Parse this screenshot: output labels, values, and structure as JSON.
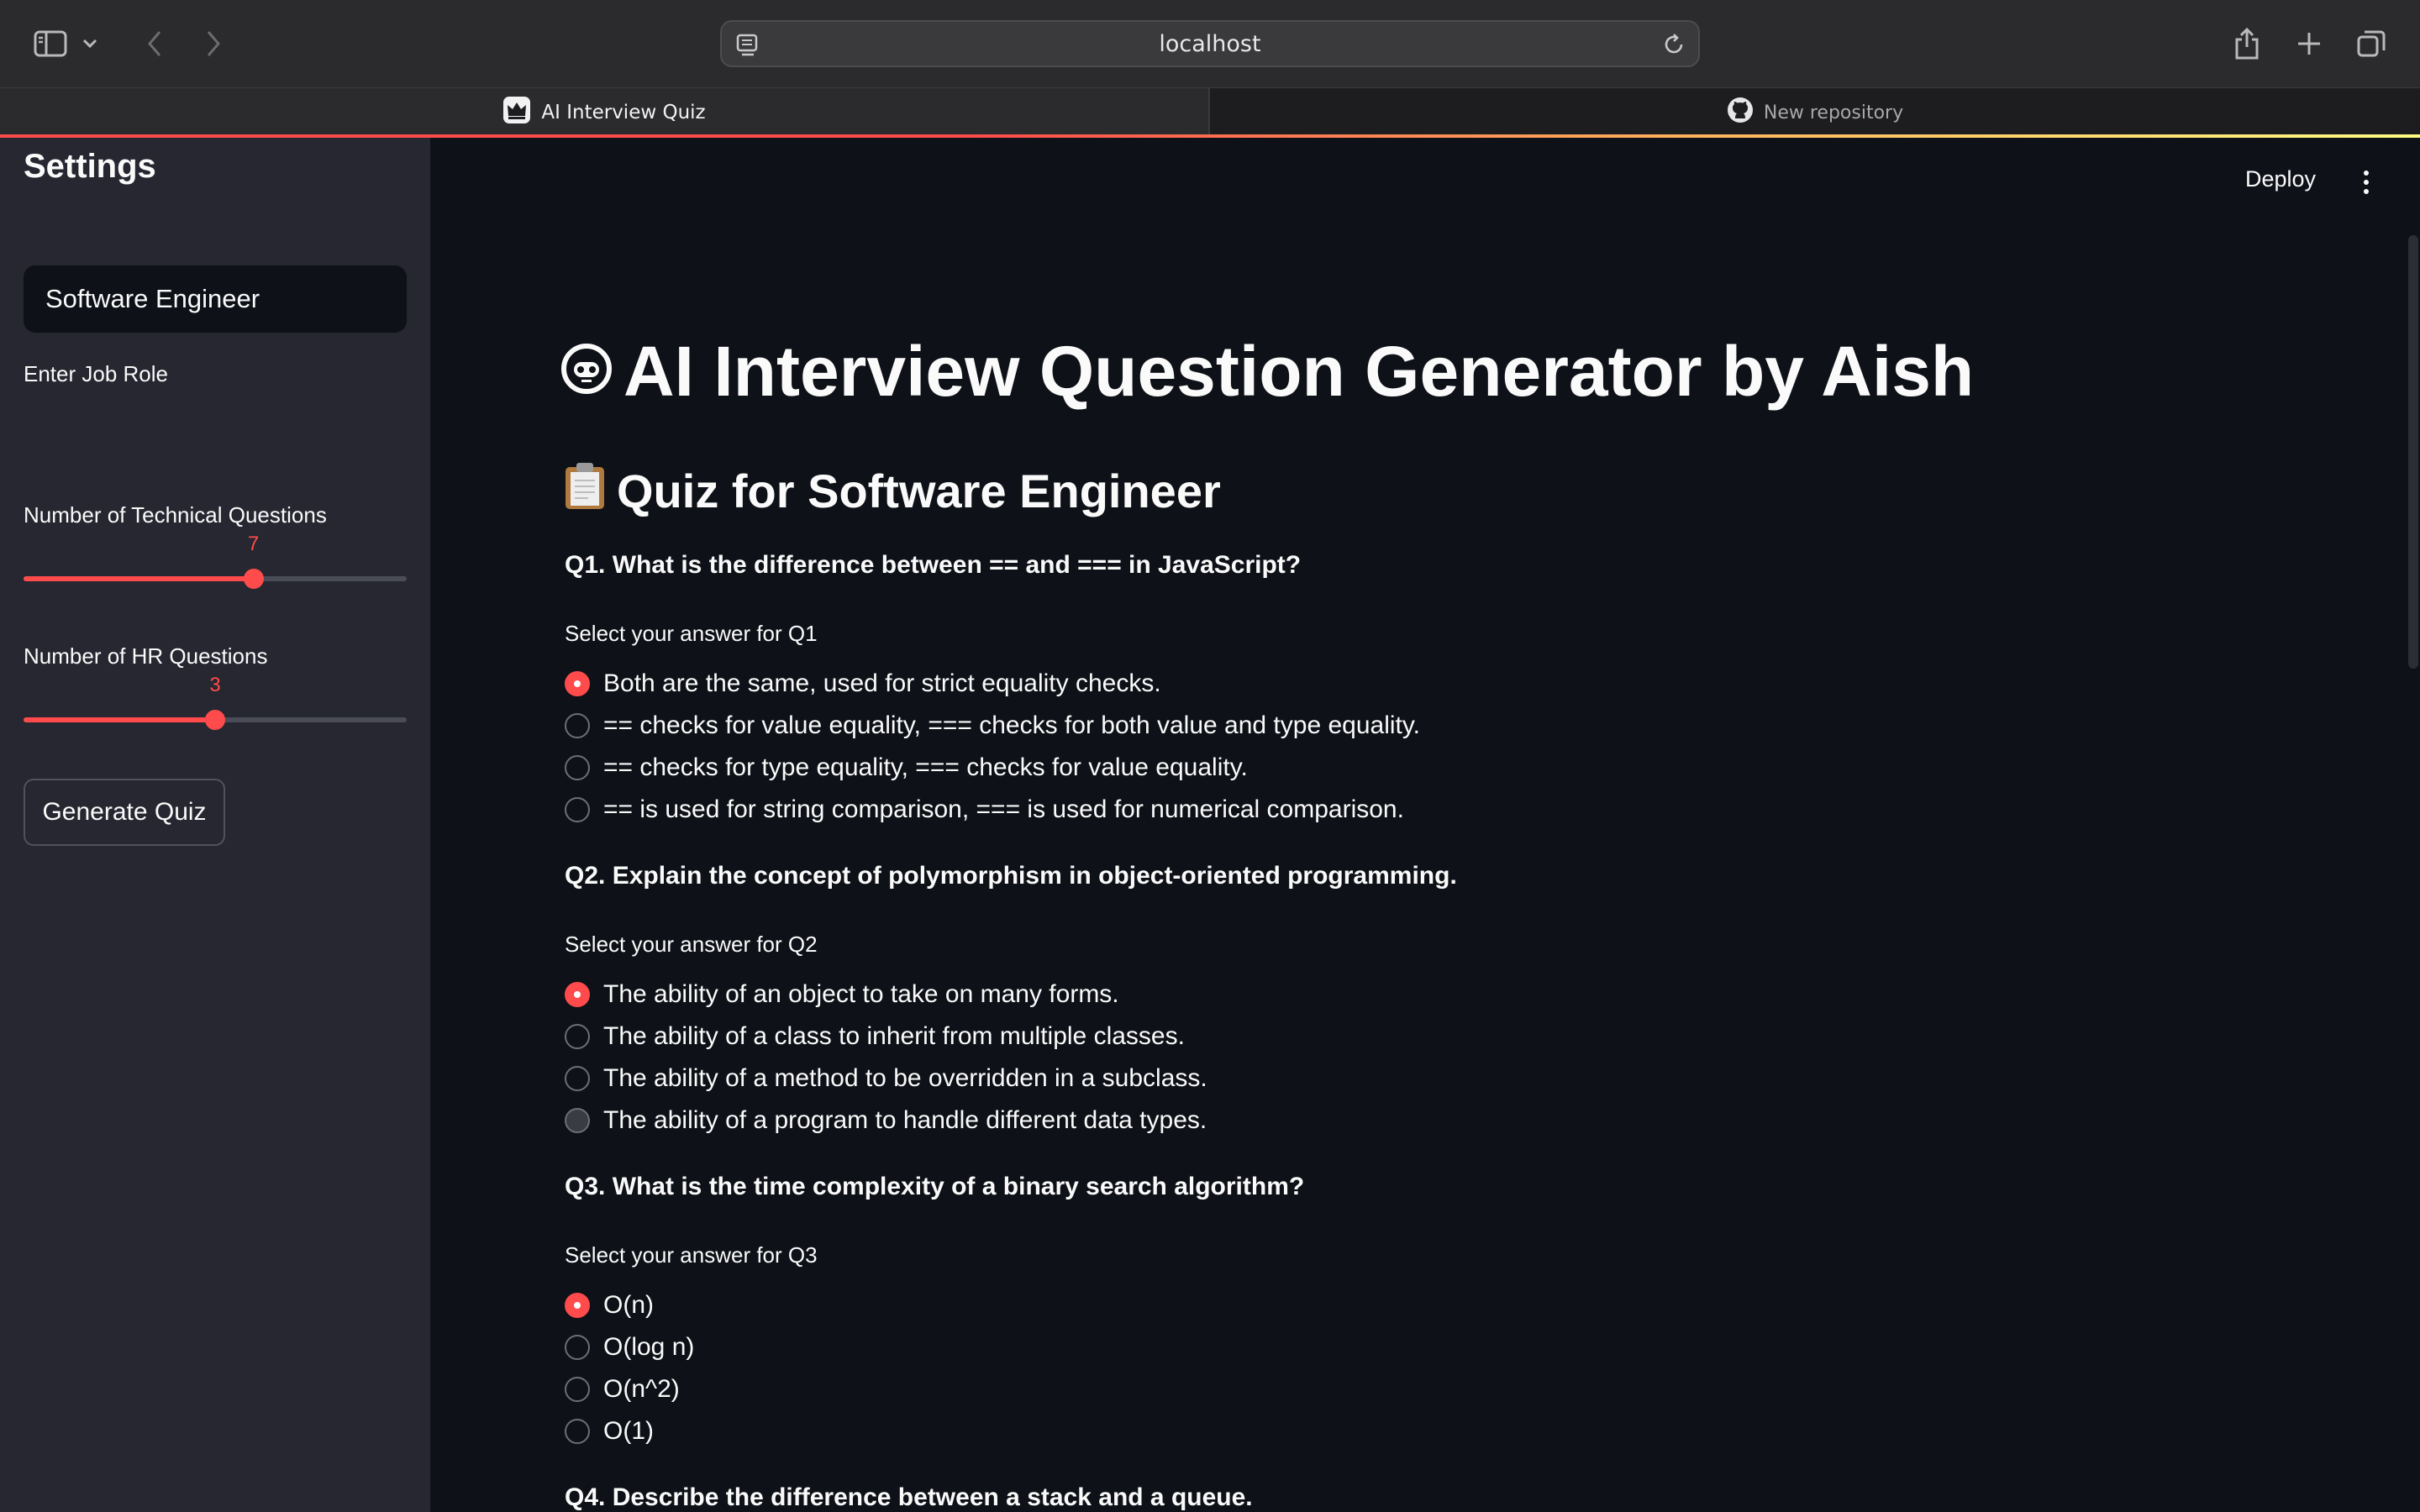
{
  "browser": {
    "url": "localhost",
    "tabs": [
      {
        "label": "AI Interview Quiz",
        "active": true,
        "icon": "crown-icon"
      },
      {
        "label": "New repository",
        "active": false,
        "icon": "github-icon"
      }
    ]
  },
  "sidebar": {
    "title": "Settings",
    "job_role_label": "Enter Job Role",
    "job_role_value": "Software Engineer",
    "technical_label": "Number of Technical Questions",
    "technical_value": "7",
    "technical_fraction": 0.6,
    "hr_label": "Number of HR Questions",
    "hr_value": "3",
    "hr_fraction": 0.5,
    "generate_button": "Generate Quiz"
  },
  "header": {
    "deploy_label": "Deploy"
  },
  "main": {
    "title": "AI Interview Question Generator by Aish",
    "title_icon": "robot-face-icon",
    "subtitle": "Quiz for Software Engineer",
    "subtitle_icon": "clipboard-icon",
    "questions": [
      {
        "text": "Q1. What is the difference between == and === in JavaScript?",
        "prompt": "Select your answer for Q1",
        "selected": 0,
        "options": [
          "Both are the same, used for strict equality checks.",
          "== checks for value equality, === checks for both value and type equality.",
          "== checks for type equality, === checks for value equality.",
          "== is used for string comparison, === is used for numerical comparison."
        ]
      },
      {
        "text": "Q2. Explain the concept of polymorphism in object-oriented programming.",
        "prompt": "Select your answer for Q2",
        "selected": 0,
        "options": [
          "The ability of an object to take on many forms.",
          "The ability of a class to inherit from multiple classes.",
          "The ability of a method to be overridden in a subclass.",
          "The ability of a program to handle different data types."
        ]
      },
      {
        "text": "Q3. What is the time complexity of a binary search algorithm?",
        "prompt": "Select your answer for Q3",
        "selected": 0,
        "options": [
          "O(n)",
          "O(log n)",
          "O(n^2)",
          "O(1)"
        ]
      },
      {
        "text": "Q4. Describe the difference between a stack and a queue."
      }
    ]
  },
  "colors": {
    "accent": "#ff4b4b",
    "background": "#0e1117",
    "sidebar": "#262730"
  }
}
